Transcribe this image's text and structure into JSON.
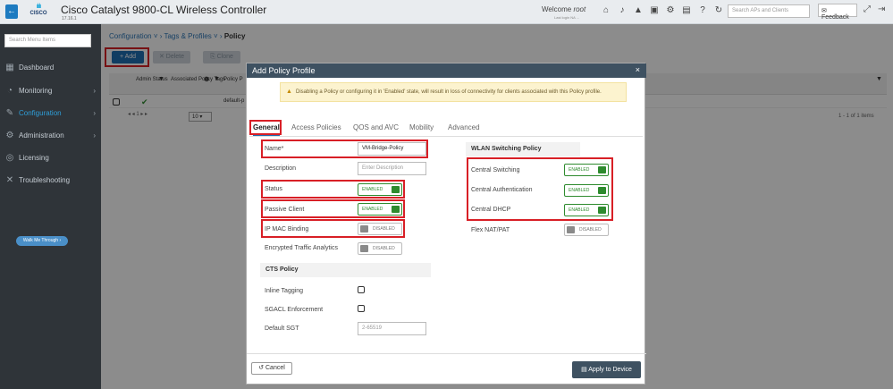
{
  "topbar": {
    "back_icon": "←",
    "logo_bars": "ılıılı",
    "logo_word": "CISCO",
    "title": "Cisco Catalyst 9800-CL Wireless Controller",
    "version": "17.16.1",
    "welcome_prefix": "Welcome",
    "user": "root",
    "last_login": "Last login NA ...",
    "search_placeholder": "Search APs and Clients",
    "feedback_label": "Feedback",
    "feedback_icon": "✉",
    "icons": [
      "home-icon",
      "bell-icon",
      "warning-icon",
      "save-icon",
      "gear-icon",
      "document-icon",
      "help-icon",
      "refresh-icon"
    ]
  },
  "sidebar": {
    "search_placeholder": "Search Menu Items",
    "items": [
      {
        "label": "Dashboard",
        "icon": "▦",
        "chevron": ""
      },
      {
        "label": "Monitoring",
        "icon": "◔",
        "chevron": "›"
      },
      {
        "label": "Configuration",
        "icon": "✎",
        "chevron": "›"
      },
      {
        "label": "Administration",
        "icon": "⚙",
        "chevron": "›"
      },
      {
        "label": "Licensing",
        "icon": "◎",
        "chevron": ""
      },
      {
        "label": "Troubleshooting",
        "icon": "✕",
        "chevron": ""
      }
    ],
    "walk_me_through": "Walk Me Through ›"
  },
  "breadcrumb": {
    "part1": "Configuration",
    "part2": "Tags & Profiles",
    "current": "Policy",
    "sep": " ˅ › "
  },
  "toolbar": {
    "add_label": "+  Add",
    "delete_label": "✕  Delete",
    "clone_label": "⎘ Clone"
  },
  "table": {
    "col_admin_status": "Admin Status",
    "col_assoc_tags": "Associated Policy Tags",
    "col_policy": "Policy P",
    "row1_policy": "default-p",
    "pager": "◂  ◂  1  ▸  ▸",
    "per_page": "10  ▾",
    "items_count": "1 - 1 of 1 items"
  },
  "modal": {
    "title": "Add Policy Profile",
    "close_icon": "×",
    "warning": "Disabling a Policy or configuring it in 'Enabled' state, will result in loss of connectivity for clients associated with this Policy profile.",
    "warning_icon": "▲",
    "tabs": [
      "General",
      "Access Policies",
      "QOS and AVC",
      "Mobility",
      "Advanced"
    ],
    "fields": {
      "name_label": "Name*",
      "name_value": "VM-Bridge-Policy",
      "description_label": "Description",
      "description_placeholder": "Enter Description",
      "status_label": "Status",
      "status_value": "ENABLED",
      "passive_client_label": "Passive Client",
      "passive_client_value": "ENABLED",
      "ip_mac_binding_label": "IP MAC Binding",
      "ip_mac_binding_value": "DISABLED",
      "encrypted_traffic_label": "Encrypted Traffic Analytics",
      "encrypted_traffic_value": "DISABLED"
    },
    "cts": {
      "heading": "CTS Policy",
      "inline_tagging_label": "Inline Tagging",
      "sgacl_label": "SGACL Enforcement",
      "default_sgt_label": "Default SGT",
      "default_sgt_placeholder": "2-65519"
    },
    "wlan_switching": {
      "heading": "WLAN Switching Policy",
      "central_switching_label": "Central Switching",
      "central_switching_value": "ENABLED",
      "central_auth_label": "Central Authentication",
      "central_auth_value": "ENABLED",
      "central_dhcp_label": "Central DHCP",
      "central_dhcp_value": "ENABLED",
      "flex_nat_label": "Flex NAT/PAT",
      "flex_nat_value": "DISABLED"
    },
    "cancel_label": "↺ Cancel",
    "apply_label": "▤  Apply to Device"
  },
  "colors": {
    "accent": "#1e6fb2",
    "highlight": "#d81f26",
    "enabled": "#2e8b2e",
    "header": "#3e5161"
  }
}
